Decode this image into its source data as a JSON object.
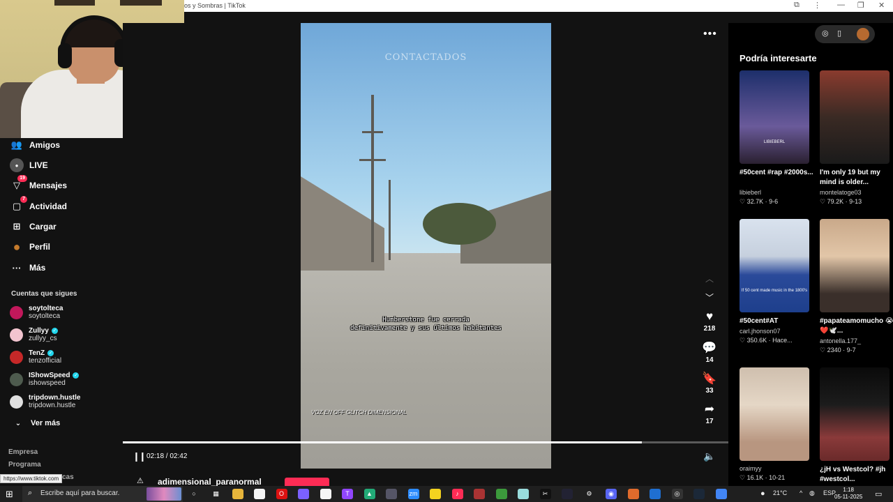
{
  "window": {
    "title": "os y Sombras | TikTok",
    "controls": [
      "⧉",
      "⋮",
      "—",
      "❐",
      "✕"
    ]
  },
  "sidebar": {
    "nav": [
      {
        "label": "Amigos",
        "icon": "friends-icon",
        "badge": ""
      },
      {
        "label": "LIVE",
        "icon": "live-icon",
        "badge": ""
      },
      {
        "label": "Mensajes",
        "icon": "messages-icon",
        "badge": "19"
      },
      {
        "label": "Actividad",
        "icon": "activity-icon",
        "badge": "7"
      },
      {
        "label": "Cargar",
        "icon": "upload-icon",
        "badge": ""
      },
      {
        "label": "Perfil",
        "icon": "profile-avatar-icon",
        "badge": ""
      },
      {
        "label": "Más",
        "icon": "more-icon",
        "badge": ""
      }
    ],
    "following_title": "Cuentas que sigues",
    "following": [
      {
        "name": "soytolteca",
        "handle": "soytolteca",
        "verified": false,
        "color": "#c2185b"
      },
      {
        "name": "Zullyy",
        "handle": "zullyy_cs",
        "verified": true,
        "color": "#f2c4cf"
      },
      {
        "name": "TenZ",
        "handle": "tenzofficial",
        "verified": true,
        "color": "#c62828"
      },
      {
        "name": "IShowSpeed",
        "handle": "ishowspeed",
        "verified": true,
        "color": "#4e5b4e"
      },
      {
        "name": "tripdown.hustle",
        "handle": "tripdown.hustle",
        "verified": false,
        "color": "#e0e0e0"
      }
    ],
    "see_more": "Ver más",
    "footer": [
      "Empresa",
      "Programa",
      "cas"
    ],
    "status_url": "https://www.tiktok.com"
  },
  "video": {
    "watermark": "CONTACTADOS",
    "subtitle_line1": "Humberstone fue cerrada",
    "subtitle_line2": "definitivamente y sus últimos habitantes",
    "credit": "VOZ EN OFF   GLITCH DIMENSIONAL",
    "likes": "218",
    "comments": "14",
    "saves": "33",
    "shares": "17",
    "time": "02:18 / 02:42",
    "progress": 0.857,
    "author": "adimensional_paranormal"
  },
  "recommend": {
    "heading": "Podría interesarte",
    "cards": [
      {
        "title": "#50cent #rap #2000s...",
        "author": "libieberl",
        "likes": "32.7K",
        "date": "9-6",
        "overlay": "LIBIEBERL",
        "bg": "linear-gradient(180deg,#1d2f6b,#6a5a9a 60%,#2a2030)"
      },
      {
        "title": "I'm only 19 but my mind is older...",
        "author": "montelatoge03",
        "likes": "79.2K",
        "date": "9-13",
        "overlay": "",
        "bg": "linear-gradient(180deg,#8a3b2e,#3a2a24 50%,#1a1a1a)"
      },
      {
        "title": "#50cent#AT",
        "author": "carl.jhonson07",
        "likes": "350.6K",
        "date": "Hace...",
        "overlay": "If 50 cent made music in the 1800's",
        "bg": "linear-gradient(180deg,#d9e2ee,#c6d0de 40%,#2a4a9a 60%,#1e3f8c)"
      },
      {
        "title": "#papateamomucho 😭❤️🕊️...",
        "author": "antonella.177_",
        "likes": "2340",
        "date": "9-7",
        "overlay": "",
        "bg": "linear-gradient(180deg,#c9a98a,#e2c6a8 40%,#3a2f2a 80%)"
      },
      {
        "title": "",
        "author": "oraimyy",
        "likes": "16.1K",
        "date": "10-21",
        "overlay": "",
        "bg": "linear-gradient(180deg,#cfbfae,#e5d7c6 40%,#b89680 80%)"
      },
      {
        "title": "¿jH vs Westcol? #jh #westcol...",
        "author": "",
        "likes": "",
        "date": "",
        "overlay": "",
        "bg": "linear-gradient(180deg,#0a0a0a,#1c1c1c 40%,#8a3a3a 75%,#6a2a2a)"
      }
    ]
  },
  "taskbar": {
    "search_placeholder": "Escribe aquí para buscar.",
    "weather": "21°C",
    "lang": "ESP",
    "time": "1:18",
    "date": "05-11-2025",
    "apps": [
      {
        "name": "task-view-icon",
        "glyph": "○",
        "color": "transparent"
      },
      {
        "name": "widgets-icon",
        "glyph": "▦",
        "color": "transparent"
      },
      {
        "name": "file-explorer-icon",
        "glyph": "",
        "color": "#e7b53b"
      },
      {
        "name": "document-icon",
        "glyph": "",
        "color": "#f5f5f5"
      },
      {
        "name": "opera-icon",
        "glyph": "O",
        "color": "#d11"
      },
      {
        "name": "copilot-icon",
        "glyph": "",
        "color": "#7b61ff"
      },
      {
        "name": "notes-icon",
        "glyph": "",
        "color": "#f5f5f5"
      },
      {
        "name": "twitch-icon",
        "glyph": "T",
        "color": "#9146ff"
      },
      {
        "name": "drive-icon",
        "glyph": "▲",
        "color": "#2a7"
      },
      {
        "name": "game-icon",
        "glyph": "",
        "color": "#556"
      },
      {
        "name": "zoom-icon",
        "glyph": "zm",
        "color": "#2d8cff"
      },
      {
        "name": "sticky-notes-icon",
        "glyph": "",
        "color": "#f3d21f"
      },
      {
        "name": "tiktok-icon",
        "glyph": "♪",
        "color": "#fe2c55"
      },
      {
        "name": "app-icon-red",
        "glyph": "",
        "color": "#a33"
      },
      {
        "name": "minecraft-icon",
        "glyph": "",
        "color": "#3c9a3c"
      },
      {
        "name": "app-icon-cyan",
        "glyph": "",
        "color": "#9dd"
      },
      {
        "name": "capcut-icon",
        "glyph": "✂",
        "color": "#111"
      },
      {
        "name": "app-icon-dark",
        "glyph": "",
        "color": "#223"
      },
      {
        "name": "settings-icon",
        "glyph": "⚙",
        "color": "transparent"
      },
      {
        "name": "discord-icon",
        "glyph": "◉",
        "color": "#5865f2"
      },
      {
        "name": "app-icon-orange",
        "glyph": "",
        "color": "#e06b2c"
      },
      {
        "name": "app-icon-blue",
        "glyph": "",
        "color": "#1f6fd1"
      },
      {
        "name": "obs-icon",
        "glyph": "◎",
        "color": "#333"
      },
      {
        "name": "steam-icon",
        "glyph": "",
        "color": "#1b2838"
      },
      {
        "name": "chrome-icon",
        "glyph": "",
        "color": "#4285f4"
      }
    ]
  }
}
